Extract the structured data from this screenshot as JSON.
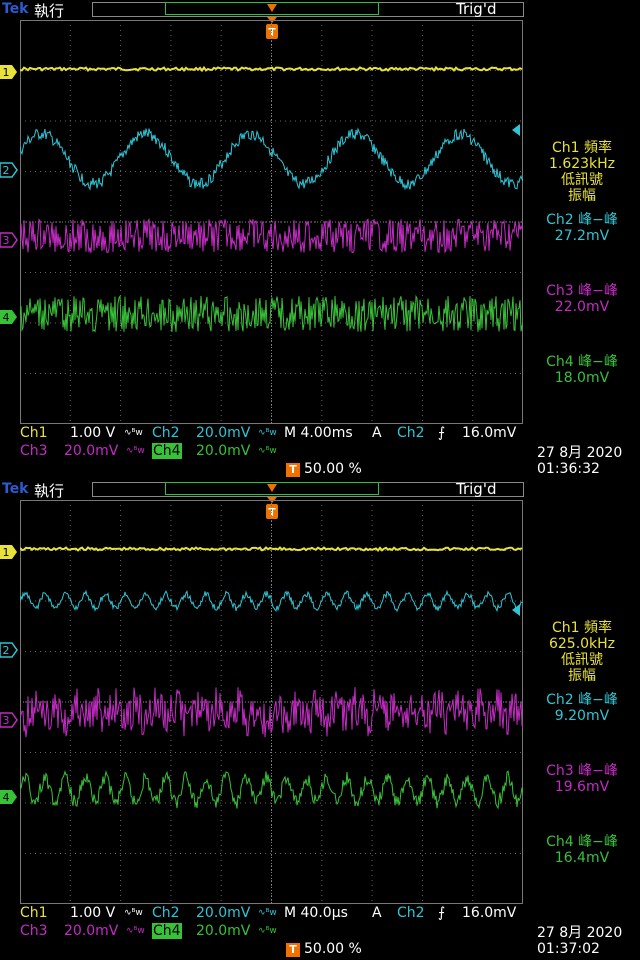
{
  "screens": [
    {
      "brand": "Tek",
      "mode": "執行",
      "trig_status": "Trig'd",
      "trigger_marker": "T",
      "channel_markers": [
        "1",
        "2",
        "3",
        "4"
      ],
      "measurements": [
        {
          "label": "Ch1 頻率",
          "value": "1.623kHz",
          "note1": "低訊號",
          "note2": "振幅",
          "color": "#e8e23a"
        },
        {
          "label": "Ch2 峰−峰",
          "value": "27.2mV",
          "color": "#2ec6d6"
        },
        {
          "label": "Ch3 峰−峰",
          "value": "22.0mV",
          "color": "#c42bc4"
        },
        {
          "label": "Ch4 峰−峰",
          "value": "18.0mV",
          "color": "#38c238"
        }
      ],
      "bottom": {
        "ch1": "Ch1",
        "ch1_scale": "1.00 V",
        "ch1_icon": "∿ᴮw",
        "ch2": "Ch2",
        "ch2_scale": "20.0mV",
        "ch2_icon": "∿ᴮw",
        "timebase": "M 4.00ms",
        "trig_mode": "A",
        "trig_ch": "Ch2",
        "trig_slope": "⨍",
        "trig_level": "16.0mV",
        "ch3": "Ch3",
        "ch3_scale": "20.0mV",
        "ch3_icon": "∿ᴮw",
        "ch4": "Ch4",
        "ch4_scale": "20.0mV",
        "ch4_icon": "∿ᴮw",
        "trig_pos_badge": "T",
        "trig_pos": "50.00 %",
        "date": "27 8月  2020",
        "time": "01:36:32"
      },
      "waves": {
        "ch2_cycles": 4.8,
        "ch2_amp": 1.0,
        "ch3_noise": 1.0,
        "ch4_noise": 1.0
      }
    },
    {
      "brand": "Tek",
      "mode": "執行",
      "trig_status": "Trig'd",
      "trigger_marker": "T",
      "channel_markers": [
        "1",
        "2",
        "3",
        "4"
      ],
      "measurements": [
        {
          "label": "Ch1 頻率",
          "value": "625.0kHz",
          "note1": "低訊號",
          "note2": "振幅",
          "color": "#e8e23a"
        },
        {
          "label": "Ch2 峰−峰",
          "value": "9.20mV",
          "color": "#2ec6d6"
        },
        {
          "label": "Ch3 峰−峰",
          "value": "19.6mV",
          "color": "#c42bc4"
        },
        {
          "label": "Ch4 峰−峰",
          "value": "16.4mV",
          "color": "#38c238"
        }
      ],
      "bottom": {
        "ch1": "Ch1",
        "ch1_scale": "1.00 V",
        "ch1_icon": "∿ᴮw",
        "ch2": "Ch2",
        "ch2_scale": "20.0mV",
        "ch2_icon": "∿ᴮw",
        "timebase": "M 40.0µs",
        "trig_mode": "A",
        "trig_ch": "Ch2",
        "trig_slope": "⨍",
        "trig_level": "16.0mV",
        "ch3": "Ch3",
        "ch3_scale": "20.0mV",
        "ch3_icon": "∿ᴮw",
        "ch4": "Ch4",
        "ch4_scale": "20.0mV",
        "ch4_icon": "∿ᴮw",
        "trig_pos_badge": "T",
        "trig_pos": "50.00 %",
        "date": "27 8月  2020",
        "time": "01:37:02"
      },
      "waves": {
        "ch2_cycles": 25,
        "ch2_amp": 0.3,
        "ch3_noise": 1.0,
        "ch4_noise": 1.0
      }
    }
  ]
}
